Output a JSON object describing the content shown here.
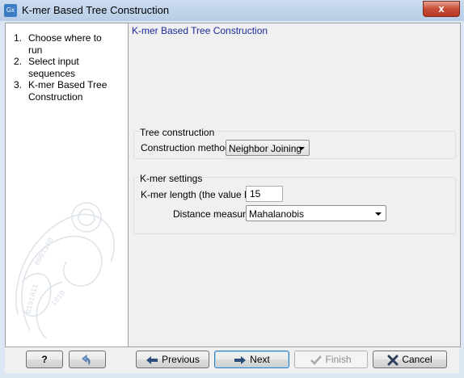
{
  "window": {
    "title": "K-mer Based Tree Construction",
    "app_icon_text": "Gx",
    "close_symbol": "x"
  },
  "steps": [
    {
      "num": "1.",
      "label": "Choose where to run"
    },
    {
      "num": "2.",
      "label": "Select input sequences"
    },
    {
      "num": "3.",
      "label": "K-mer Based Tree Construction"
    }
  ],
  "content": {
    "title": "K-mer Based Tree Construction",
    "tree_group": {
      "title": "Tree construction",
      "method_label": "Construction method",
      "method_value": "Neighbor Joining"
    },
    "kmer_group": {
      "title": "K-mer settings",
      "length_label": "K-mer length (the value k)",
      "length_value": "15",
      "distance_label": "Distance measure",
      "distance_value": "Mahalanobis"
    }
  },
  "buttons": {
    "help": "?",
    "previous": "Previous",
    "next": "Next",
    "finish": "Finish",
    "cancel": "Cancel"
  },
  "icons": {
    "help": "question-icon",
    "reset": "undo-arrow-icon",
    "previous": "left-arrow-icon",
    "next": "right-arrow-icon",
    "finish": "check-icon",
    "cancel": "x-icon"
  }
}
